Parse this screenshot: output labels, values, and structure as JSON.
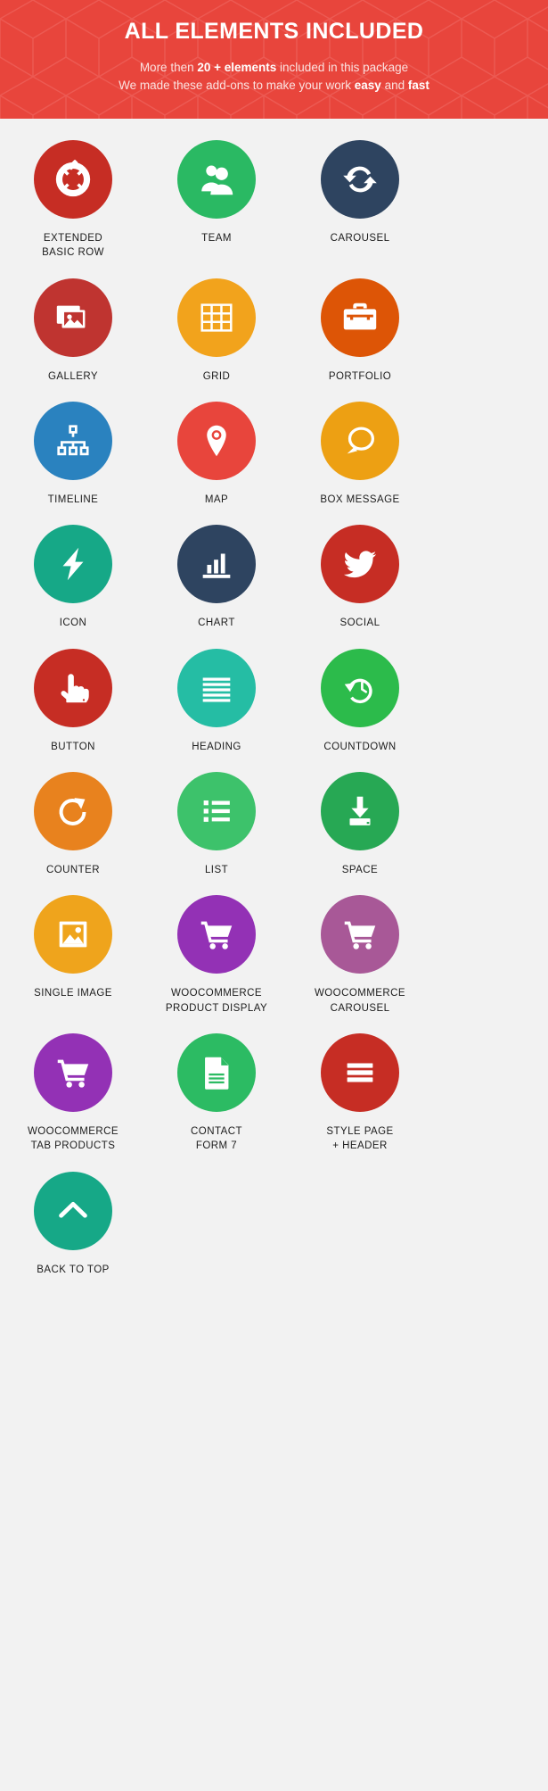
{
  "header": {
    "title": "ALL ELEMENTS INCLUDED",
    "line1_pre": "More then ",
    "line1_strong": "20 + elements",
    "line1_post": " included in this package",
    "line2_pre": "We made these add-ons to make your work ",
    "line2_strong1": "easy",
    "line2_mid": " and ",
    "line2_strong2": "fast",
    "bg_color": "#e8453c",
    "text_color": "#ffffff"
  },
  "page": {
    "background": "#f2f2f2",
    "label_color": "#1c1c1c"
  },
  "items": [
    {
      "label": "EXTENDED\nBASIC ROW",
      "icon": "lifebuoy-icon",
      "color": "#c62d24"
    },
    {
      "label": "TEAM",
      "icon": "users-icon",
      "color": "#2ab963"
    },
    {
      "label": "CAROUSEL",
      "icon": "refresh-cycle-icon",
      "color": "#2e4460"
    },
    {
      "label": "GALLERY",
      "icon": "gallery-images-icon",
      "color": "#bf3430"
    },
    {
      "label": "GRID",
      "icon": "grid-table-icon",
      "color": "#f2a31c"
    },
    {
      "label": "PORTFOLIO",
      "icon": "briefcase-icon",
      "color": "#dd5506"
    },
    {
      "label": "TIMELINE",
      "icon": "sitemap-icon",
      "color": "#2a82bf"
    },
    {
      "label": "MAP",
      "icon": "map-pin-icon",
      "color": "#e8453c"
    },
    {
      "label": "BOX MESSAGE",
      "icon": "chat-bubble-icon",
      "color": "#eda013"
    },
    {
      "label": "ICON",
      "icon": "lightning-bolt-icon",
      "color": "#16a887"
    },
    {
      "label": "CHART",
      "icon": "bar-chart-icon",
      "color": "#2e4460"
    },
    {
      "label": "SOCIAL",
      "icon": "twitter-bird-icon",
      "color": "#c62d24"
    },
    {
      "label": "BUTTON",
      "icon": "pointing-hand-icon",
      "color": "#c62d24"
    },
    {
      "label": "HEADING",
      "icon": "heading-lines-icon",
      "color": "#25bda4"
    },
    {
      "label": "COUNTDOWN",
      "icon": "countdown-clock-icon",
      "color": "#2cbb4b"
    },
    {
      "label": "COUNTER",
      "icon": "counter-reload-icon",
      "color": "#e8821e"
    },
    {
      "label": "LIST",
      "icon": "bullet-list-icon",
      "color": "#3dc26b"
    },
    {
      "label": "SPACE",
      "icon": "download-tray-icon",
      "color": "#27a854"
    },
    {
      "label": "SINGLE IMAGE",
      "icon": "single-image-icon",
      "color": "#efa41c"
    },
    {
      "label": "WOOCOMMERCE\nPRODUCT DISPLAY",
      "icon": "shopping-cart-icon",
      "color": "#9331b5"
    },
    {
      "label": "WOOCOMMERCE\nCAROUSEL",
      "icon": "shopping-cart-icon",
      "color": "#a85897"
    },
    {
      "label": "WOOCOMMERCE\nTAB PRODUCTS",
      "icon": "shopping-cart-icon",
      "color": "#9331b5"
    },
    {
      "label": "CONTACT\nFORM 7",
      "icon": "document-file-icon",
      "color": "#2cbb63"
    },
    {
      "label": "STYLE PAGE\n+ HEADER",
      "icon": "hamburger-menu-icon",
      "color": "#c62d24"
    },
    {
      "label": "BACK TO TOP",
      "icon": "chevron-up-icon",
      "color": "#16a887"
    }
  ]
}
